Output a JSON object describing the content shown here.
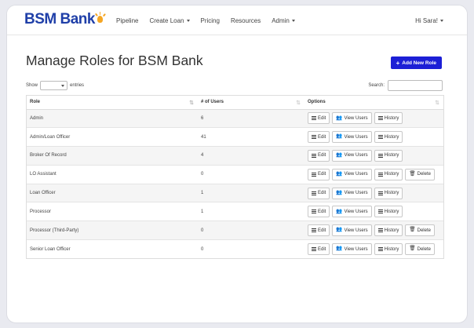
{
  "nav": {
    "brand": "BSM Bank",
    "links": [
      {
        "label": "Pipeline",
        "dropdown": false
      },
      {
        "label": "Create Loan",
        "dropdown": true
      },
      {
        "label": "Pricing",
        "dropdown": false
      },
      {
        "label": "Resources",
        "dropdown": false
      },
      {
        "label": "Admin",
        "dropdown": true
      }
    ],
    "user_greeting": "Hi Sara!"
  },
  "page": {
    "title": "Manage Roles for BSM Bank",
    "add_button_label": "Add New Role",
    "accent_color": "#1c1fd6"
  },
  "controls": {
    "show_label": "Show",
    "entries_label": "entries",
    "search_label": "Search:",
    "search_value": ""
  },
  "table": {
    "columns": [
      "Role",
      "# of Users",
      "Options"
    ],
    "buttons": {
      "edit": "Edit",
      "view_users": "View Users",
      "history": "History",
      "delete": "Delete"
    },
    "rows": [
      {
        "role": "Admin",
        "users": "6",
        "deletable": false
      },
      {
        "role": "Admin/Loan Officer",
        "users": "41",
        "deletable": false
      },
      {
        "role": "Broker Of Record",
        "users": "4",
        "deletable": false
      },
      {
        "role": "LO Assistant",
        "users": "0",
        "deletable": true
      },
      {
        "role": "Loan Officer",
        "users": "1",
        "deletable": false
      },
      {
        "role": "Processor",
        "users": "1",
        "deletable": false
      },
      {
        "role": "Processor (Third-Party)",
        "users": "0",
        "deletable": true
      },
      {
        "role": "Senior Loan Officer",
        "users": "0",
        "deletable": true
      }
    ]
  }
}
